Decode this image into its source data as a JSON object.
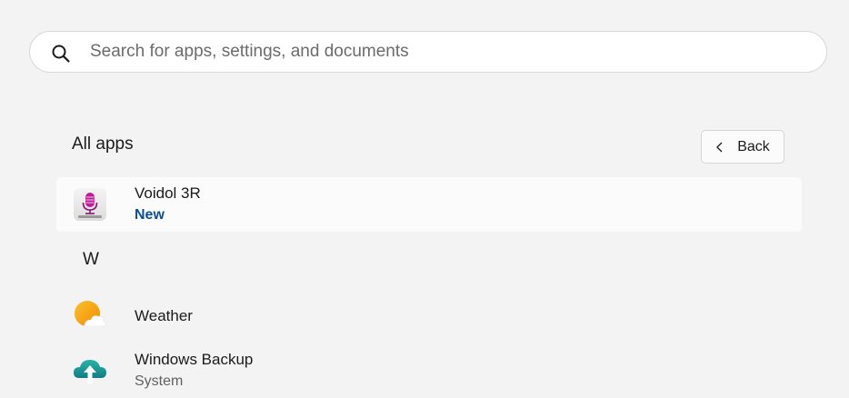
{
  "search": {
    "placeholder": "Search for apps, settings, and documents",
    "value": ""
  },
  "all_apps": {
    "title": "All apps",
    "back_label": "Back"
  },
  "apps": [
    {
      "name": "Voidol 3R",
      "badge": "New",
      "icon": "voidol-microphone-icon"
    },
    {
      "name": "Weather",
      "icon": "weather-icon"
    },
    {
      "name": "Windows Backup",
      "subtitle": "System",
      "icon": "cloud-backup-icon"
    }
  ],
  "letter_group": "W",
  "colors": {
    "new_badge": "#0b4f94",
    "background": "#f3f3f3",
    "weather_sun": "#f5a623",
    "backup_cloud": "#1e9a98"
  }
}
